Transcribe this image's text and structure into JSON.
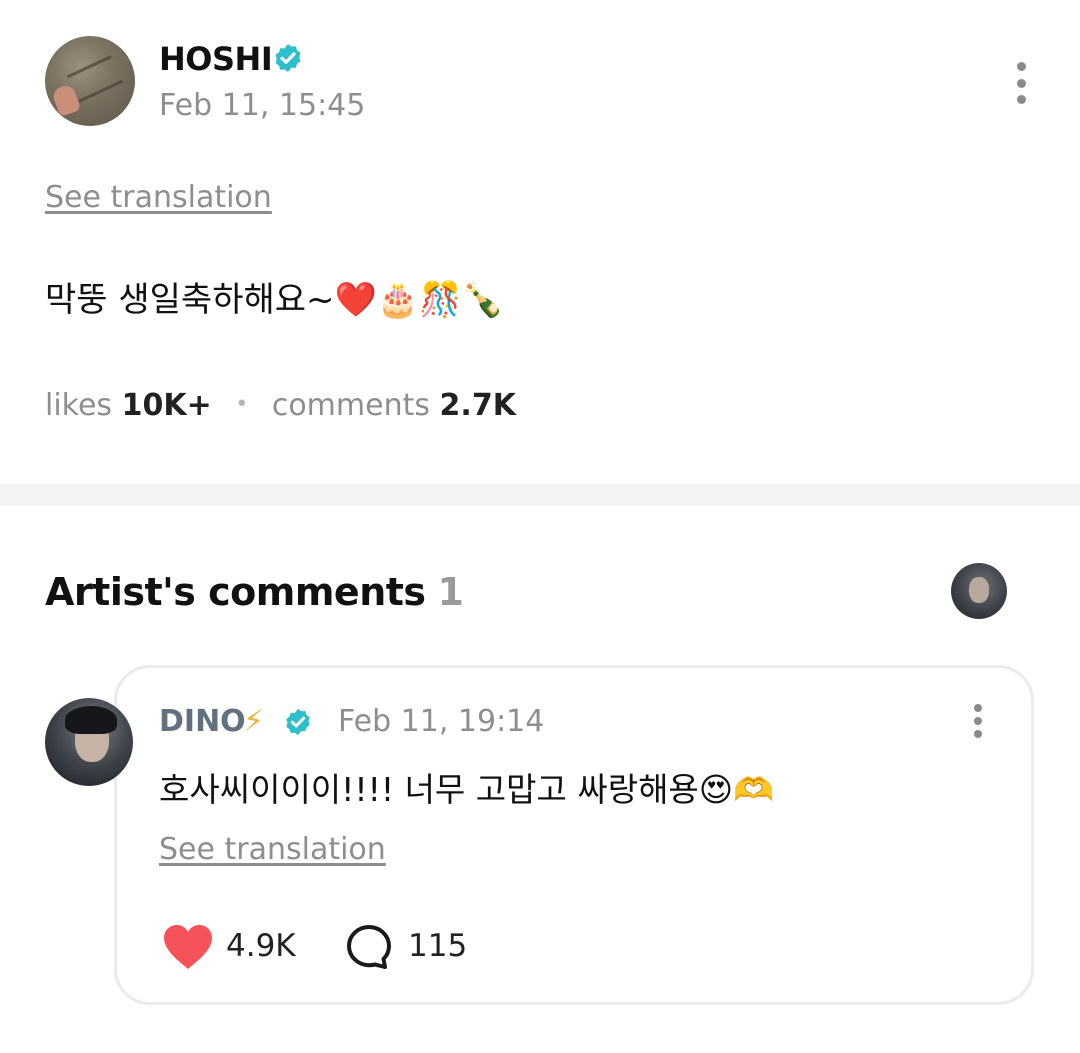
{
  "post": {
    "author": "HOSHI",
    "time": "Feb 11, 15:45",
    "see_translation": "See translation",
    "body": "막뚱 생일축하해요~❤️🎂🎊🍾",
    "likes_label": "likes",
    "likes_count": "10K+",
    "comments_label": "comments",
    "comments_count": "2.7K"
  },
  "artist_comments": {
    "title": "Artist's comments",
    "count": "1"
  },
  "comment": {
    "author": "DINO",
    "bolt_icon": "⚡",
    "time": "Feb 11, 19:14",
    "body": "호사씨이이이!!!! 너무 고맙고 싸랑해용😍🫶",
    "see_translation": "See translation",
    "likes": "4.9K",
    "replies": "115"
  },
  "icons": {
    "verified": "verified-badge-icon",
    "more": "more-vertical-icon",
    "like": "heart-icon",
    "reply": "comment-bubble-icon"
  },
  "colors": {
    "verified": "#2ebfcc",
    "heart": "#f5525a",
    "muted_text": "#8e8e8e",
    "comment_author": "#62717f",
    "bolt": "#f3b23a",
    "divider": "#f3f3f3"
  }
}
